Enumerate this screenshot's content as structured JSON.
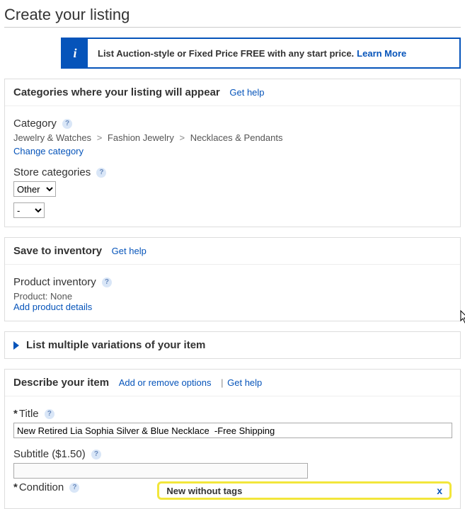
{
  "page": {
    "title": "Create your listing"
  },
  "banner": {
    "icon_label": "i",
    "text": "List Auction-style or Fixed Price FREE with any start price.",
    "learn_more": "Learn More"
  },
  "categories": {
    "section_title": "Categories where your listing will appear",
    "get_help": "Get help",
    "category_label": "Category",
    "breadcrumb": [
      "Jewelry & Watches",
      "Fashion Jewelry",
      "Necklaces & Pendants"
    ],
    "change_link": "Change category",
    "store_label": "Store categories",
    "store_select_1": "Other",
    "store_select_2": "-"
  },
  "inventory": {
    "section_title": "Save to inventory",
    "get_help": "Get help",
    "product_label": "Product inventory",
    "product_value": "Product: None",
    "add_link": "Add product details"
  },
  "variations": {
    "title": "List multiple variations of your item"
  },
  "describe": {
    "section_title": "Describe your item",
    "options_link": "Add or remove options",
    "get_help": "Get help",
    "title_label": "Title",
    "title_value": "New Retired Lia Sophia Silver & Blue Necklace  -Free Shipping",
    "subtitle_label": "Subtitle ($1.50)",
    "subtitle_value": "",
    "condition_label": "Condition",
    "condition_popup": "New without tags",
    "required_mark": "*",
    "separator": "|"
  },
  "close_x": "x"
}
